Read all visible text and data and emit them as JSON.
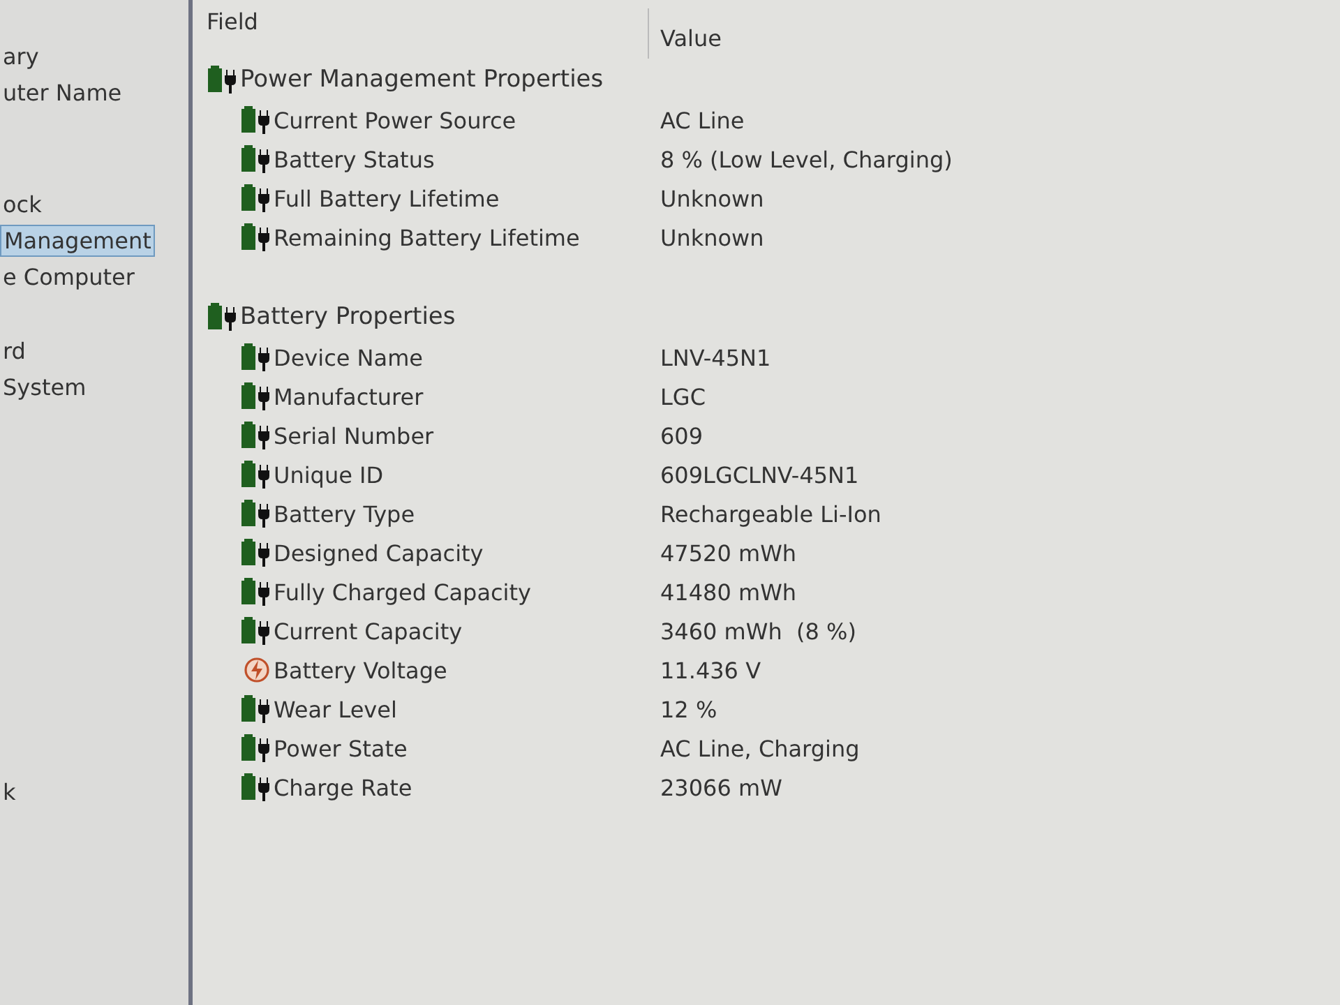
{
  "sidebar": {
    "items": [
      {
        "label": "ary",
        "selected": false
      },
      {
        "label": "uter Name",
        "selected": false
      },
      {
        "label": "ock",
        "selected": false
      },
      {
        "label": "Management",
        "selected": true
      },
      {
        "label": "e Computer",
        "selected": false
      },
      {
        "label": "rd",
        "selected": false
      },
      {
        "label": "System",
        "selected": false
      },
      {
        "label": "k",
        "selected": false
      }
    ]
  },
  "table": {
    "columns": [
      "Field",
      "Value"
    ],
    "groups": [
      {
        "title": "Power Management Properties",
        "rows": [
          {
            "kind": "battery",
            "field": "Current Power Source",
            "value": "AC Line"
          },
          {
            "kind": "battery",
            "field": "Battery Status",
            "value": "8 % (Low Level, Charging)"
          },
          {
            "kind": "battery",
            "field": "Full Battery Lifetime",
            "value": "Unknown"
          },
          {
            "kind": "battery",
            "field": "Remaining Battery Lifetime",
            "value": "Unknown"
          }
        ]
      },
      {
        "title": "Battery Properties",
        "rows": [
          {
            "kind": "battery",
            "field": "Device Name",
            "value": "LNV-45N1"
          },
          {
            "kind": "battery",
            "field": "Manufacturer",
            "value": "LGC"
          },
          {
            "kind": "battery",
            "field": "Serial Number",
            "value": "609"
          },
          {
            "kind": "battery",
            "field": "Unique ID",
            "value": "609LGCLNV-45N1"
          },
          {
            "kind": "battery",
            "field": "Battery Type",
            "value": "Rechargeable Li-Ion"
          },
          {
            "kind": "battery",
            "field": "Designed Capacity",
            "value": "47520 mWh"
          },
          {
            "kind": "battery",
            "field": "Fully Charged Capacity",
            "value": "41480 mWh"
          },
          {
            "kind": "battery",
            "field": "Current Capacity",
            "value": "3460 mWh  (8 %)"
          },
          {
            "kind": "voltage",
            "field": "Battery Voltage",
            "value": "11.436 V"
          },
          {
            "kind": "battery",
            "field": "Wear Level",
            "value": "12 %"
          },
          {
            "kind": "battery",
            "field": "Power State",
            "value": "AC Line, Charging"
          },
          {
            "kind": "battery",
            "field": "Charge Rate",
            "value": "23066 mW"
          }
        ]
      }
    ]
  }
}
